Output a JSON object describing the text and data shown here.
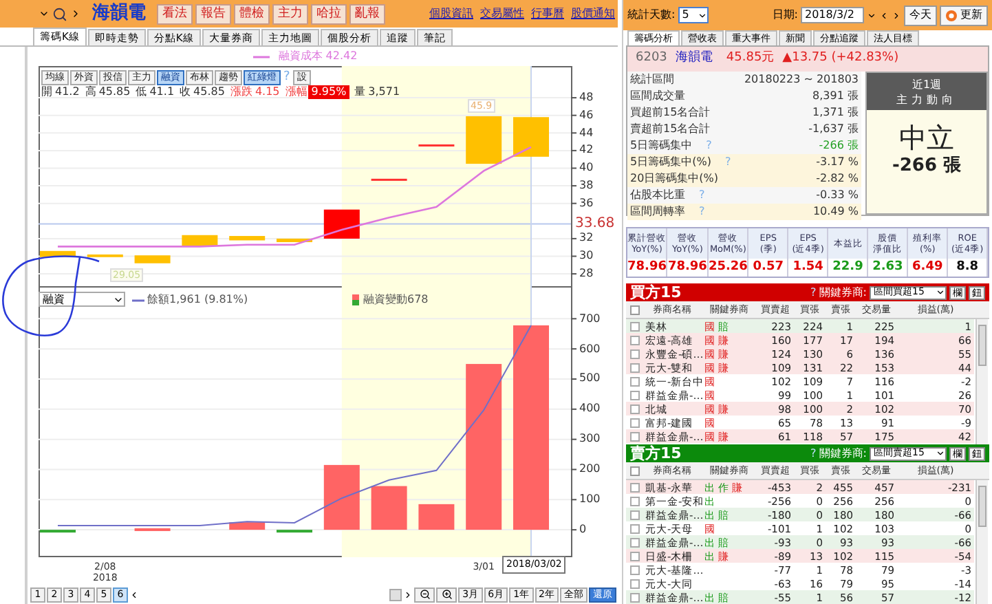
{
  "header": {
    "stock": "海韻電",
    "buttons": [
      "看法",
      "報告",
      "體檢",
      "主力",
      "哈拉",
      "亂報"
    ],
    "links": [
      "個股資訊",
      "交易屬性",
      "行事曆",
      "股價通知"
    ]
  },
  "tabs": [
    {
      "label": "籌碼K線",
      "selected": true
    },
    {
      "label": "即時走勢",
      "selected": false
    },
    {
      "label": "分點K線",
      "selected": false
    },
    {
      "label": "大量券商",
      "selected": false
    },
    {
      "label": "主力地圖",
      "selected": false
    },
    {
      "label": "個股分析",
      "selected": false
    },
    {
      "label": "追蹤",
      "selected": false
    },
    {
      "label": "筆記",
      "selected": false
    }
  ],
  "price_chart": {
    "tools": [
      {
        "kind": "button",
        "label": "均線",
        "selected": false
      },
      {
        "kind": "button",
        "label": "外資",
        "selected": false
      },
      {
        "kind": "button",
        "label": "投信",
        "selected": false
      },
      {
        "kind": "button",
        "label": "主力",
        "selected": false
      },
      {
        "kind": "button",
        "label": "融資",
        "selected": true
      },
      {
        "kind": "button",
        "label": "布林",
        "selected": false
      },
      {
        "kind": "button",
        "label": "趨勢",
        "selected": false
      },
      {
        "kind": "button",
        "label": "紅綠燈",
        "selected": true
      },
      {
        "kind": "hint",
        "label": "?"
      },
      {
        "kind": "button",
        "label": "設",
        "selected": false
      }
    ],
    "quote": [
      {
        "kind": "plain",
        "label": "開",
        "value": "41.2"
      },
      {
        "kind": "plain",
        "label": "高",
        "value": "45.85"
      },
      {
        "kind": "plain",
        "label": "低",
        "value": "41.1"
      },
      {
        "kind": "plain",
        "label": "收",
        "value": "45.85"
      },
      {
        "kind": "up",
        "label": "漲跌",
        "value": "4.15"
      },
      {
        "kind": "badge",
        "label": "漲幅",
        "value": "9.95%"
      },
      {
        "kind": "plain",
        "label": "量",
        "value": "3,571"
      }
    ],
    "high_label": "45.9",
    "low_label": "29.05",
    "chart_data": {
      "type": "line",
      "ylim": [
        26.6,
        51.6
      ],
      "yticks": [
        28,
        30,
        32,
        36,
        38,
        40,
        42,
        44,
        46,
        48
      ],
      "grid": true,
      "ref_lines": [
        {
          "axis": "y",
          "value": 33.68,
          "label": "33.68",
          "color": "#b8c8ee"
        }
      ],
      "series": [
        {
          "name": "融資成本 42.42",
          "color": "#dd77dd",
          "values": [
            31.1,
            31.1,
            31.1,
            31.1,
            31.3,
            31.3,
            33.0,
            34.4,
            35.6,
            39.7,
            42.4
          ]
        }
      ]
    }
  },
  "margin_chart": {
    "indicator": "融資",
    "chart_data": {
      "type": "bar",
      "ylim": [
        -91,
        808
      ],
      "yticks": [
        0,
        100,
        200,
        300,
        400,
        500,
        600,
        700
      ],
      "grid": true,
      "legend": "top",
      "series": [
        {
          "name": "餘額1,961 (9.81%)",
          "type": "line",
          "color": "#6f6fc8",
          "values": [
            14,
            14,
            14,
            14,
            27,
            23,
            105,
            165,
            197,
            397,
            678
          ]
        },
        {
          "name": "融資變動678",
          "type": "bar",
          "color": "#ff6464",
          "values": [
            null,
            null,
            5,
            null,
            25,
            null,
            215,
            145,
            85,
            550,
            678
          ]
        },
        {
          "type": "bar",
          "color": "#33aa33",
          "values": [
            -8,
            null,
            null,
            null,
            null,
            -8,
            null,
            null,
            null,
            null,
            null
          ]
        }
      ]
    }
  },
  "dates": [
    {
      "label": "2/08",
      "sub": "2018"
    },
    {
      "label": "3/01"
    }
  ],
  "cursor_date": "2018/03/02",
  "pages": [
    {
      "label": "1",
      "selected": false
    },
    {
      "label": "2",
      "selected": false
    },
    {
      "label": "3",
      "selected": false
    },
    {
      "label": "4",
      "selected": false
    },
    {
      "label": "5",
      "selected": false
    },
    {
      "label": "6",
      "selected": true
    }
  ],
  "ranges": [
    {
      "label": "3月",
      "selected": false
    },
    {
      "label": "6月",
      "selected": false
    },
    {
      "label": "1年",
      "selected": false
    },
    {
      "label": "2年",
      "selected": false
    },
    {
      "label": "全部",
      "selected": false
    },
    {
      "label": "還原",
      "selected": true
    }
  ],
  "toolbar": {
    "days_label": "統計天數:",
    "days": "5",
    "date_label": "日期:",
    "date": "2018/3/2",
    "today": "今天",
    "refresh": "更新"
  },
  "right_tabs": [
    {
      "label": "籌碼分析",
      "selected": true
    },
    {
      "label": "營收表",
      "selected": false
    },
    {
      "label": "重大事件",
      "selected": false
    },
    {
      "label": "新聞",
      "selected": false
    },
    {
      "label": "分點追蹤",
      "selected": false
    },
    {
      "label": "法人目標",
      "selected": false
    }
  ],
  "stock": {
    "code": "6203",
    "name": "海韻電",
    "price": "45.85元",
    "change": "▲13.75 (+42.83%)"
  },
  "stats": [
    {
      "label": "統計區間",
      "value": "20180223 ~ 201803",
      "shaded": false,
      "color": "#333333"
    },
    {
      "label": "區間成交量",
      "value": "8,391 張",
      "shaded": false,
      "color": "#333333"
    },
    {
      "label": "買超前15名合計",
      "value": "1,371 張",
      "shaded": false,
      "color": "#333333"
    },
    {
      "label": "賣超前15名合計",
      "value": "-1,637 張",
      "shaded": false,
      "color": "#333333"
    },
    {
      "label": "5日籌碼集中",
      "hint": "?",
      "value": "-266 張",
      "shaded": false,
      "color": "#22a022"
    },
    {
      "label": "5日籌碼集中(%)",
      "hint": "?",
      "value": "-3.17 %",
      "shaded": true,
      "color": "#333333"
    },
    {
      "label": "20日籌碼集中(%)",
      "value": "-2.82 %",
      "shaded": true,
      "color": "#333333"
    },
    {
      "label": "佔股本比重",
      "hint": "?",
      "value": "-0.33 %",
      "shaded": false,
      "color": "#333333"
    },
    {
      "label": "區間周轉率",
      "hint": "?",
      "value": "10.49 %",
      "shaded": true,
      "color": "#333333"
    }
  ],
  "trend": {
    "period": "近1週",
    "title": "主力動向",
    "verdict": "中立",
    "amount": "-266 張"
  },
  "fundamentals": [
    {
      "title": "累計營收",
      "sub": "YoY(%)",
      "value": "78.96",
      "color": "#e00000"
    },
    {
      "title": "營收",
      "sub": "YoY(%)",
      "value": "78.96",
      "color": "#e00000"
    },
    {
      "title": "營收",
      "sub": "MoM(%)",
      "value": "25.26",
      "color": "#e00000"
    },
    {
      "title": "EPS",
      "sub": "(季)",
      "value": "0.57",
      "color": "#e00000"
    },
    {
      "title": "EPS",
      "sub": "(近4季)",
      "value": "1.54",
      "color": "#e00000"
    },
    {
      "title": "本益比",
      "value": "22.9",
      "color": "#1a9a1a"
    },
    {
      "title": "股價",
      "sub": "淨值比",
      "value": "2.63",
      "color": "#1a9a1a"
    },
    {
      "title": "殖利率",
      "sub": "(%)",
      "value": "6.49",
      "color": "#e00000"
    },
    {
      "title": "ROE",
      "sub": "(近4季)",
      "value": "8.8",
      "color": "#111111"
    }
  ],
  "buy": {
    "title": "買方15",
    "all_checked": false,
    "hint": "?",
    "key_label": "關鍵券商:",
    "filter": "區間買超15",
    "buttons": [
      "欄",
      "鈕"
    ],
    "columns": [
      "券商名稱",
      "關鍵券商",
      "買賣超",
      "買張",
      "賣張",
      "交易量",
      "損益(萬)"
    ],
    "rows": [
      {
        "checked": false,
        "broker": "美林",
        "tags": [
          {
            "text": "國",
            "color": "#e02020"
          },
          {
            "text": "賠",
            "color": "#1a9a1a"
          }
        ],
        "net": "223",
        "buy": "224",
        "sell": "1",
        "volume": "225",
        "pl": "1",
        "color": "#e8f3e8"
      },
      {
        "checked": false,
        "broker": "宏遠-高雄",
        "tags": [
          {
            "text": "國",
            "color": "#e02020"
          },
          {
            "text": "賺",
            "color": "#e02020"
          }
        ],
        "net": "160",
        "buy": "177",
        "sell": "17",
        "volume": "194",
        "pl": "66",
        "color": "#fbe6e6"
      },
      {
        "checked": false,
        "broker": "永豐金-碩…",
        "tags": [
          {
            "text": "國",
            "color": "#e02020"
          },
          {
            "text": "賺",
            "color": "#e02020"
          }
        ],
        "net": "124",
        "buy": "130",
        "sell": "6",
        "volume": "136",
        "pl": "55",
        "color": "#fbe6e6"
      },
      {
        "checked": false,
        "broker": "元大-雙和",
        "tags": [
          {
            "text": "國",
            "color": "#e02020"
          },
          {
            "text": "賺",
            "color": "#e02020"
          }
        ],
        "net": "109",
        "buy": "131",
        "sell": "22",
        "volume": "153",
        "pl": "44",
        "color": "#fbe6e6"
      },
      {
        "checked": false,
        "broker": "統一-新台中",
        "tags": [
          {
            "text": "國",
            "color": "#e02020"
          }
        ],
        "net": "102",
        "buy": "109",
        "sell": "7",
        "volume": "116",
        "pl": "-2",
        "color": "#ffffff"
      },
      {
        "checked": false,
        "broker": "群益金鼎-…",
        "tags": [
          {
            "text": "國",
            "color": "#e02020"
          }
        ],
        "net": "99",
        "buy": "100",
        "sell": "1",
        "volume": "101",
        "pl": "26",
        "color": "#ffffff"
      },
      {
        "checked": false,
        "broker": "北城",
        "tags": [
          {
            "text": "國",
            "color": "#e02020"
          },
          {
            "text": "賺",
            "color": "#e02020"
          }
        ],
        "net": "98",
        "buy": "100",
        "sell": "2",
        "volume": "102",
        "pl": "70",
        "color": "#fbe6e6"
      },
      {
        "checked": false,
        "broker": "富邦-建國",
        "tags": [
          {
            "text": "國",
            "color": "#e02020"
          }
        ],
        "net": "65",
        "buy": "78",
        "sell": "13",
        "volume": "91",
        "pl": "-9",
        "color": "#ffffff"
      },
      {
        "checked": false,
        "broker": "群益金鼎-…",
        "tags": [
          {
            "text": "國",
            "color": "#e02020"
          },
          {
            "text": "賺",
            "color": "#e02020"
          }
        ],
        "net": "61",
        "buy": "118",
        "sell": "57",
        "volume": "175",
        "pl": "42",
        "color": "#fbe6e6"
      }
    ]
  },
  "sell": {
    "title": "賣方15",
    "all_checked": false,
    "hint": "?",
    "key_label": "關鍵券商:",
    "filter": "區間賣超15",
    "buttons": [
      "欄",
      "鈕"
    ],
    "columns": [
      "券商名稱",
      "關鍵券商",
      "買賣超",
      "買張",
      "賣張",
      "交易量",
      "損益(萬)"
    ],
    "rows": [
      {
        "checked": false,
        "broker": "凱基-永華",
        "tags": [
          {
            "text": "出",
            "color": "#1a9a1a"
          },
          {
            "text": "作",
            "color": "#1a9a1a"
          },
          {
            "text": "賺",
            "color": "#e02020"
          }
        ],
        "net": "-453",
        "buy": "2",
        "sell": "455",
        "volume": "457",
        "pl": "-231",
        "color": "#fbe6e6"
      },
      {
        "checked": false,
        "broker": "第一金-安和",
        "tags": [
          {
            "text": "出",
            "color": "#1a9a1a"
          }
        ],
        "net": "-256",
        "buy": "0",
        "sell": "256",
        "volume": "256",
        "pl": "0",
        "color": "#ffffff"
      },
      {
        "checked": false,
        "broker": "群益金鼎-…",
        "tags": [
          {
            "text": "出",
            "color": "#1a9a1a"
          },
          {
            "text": "賠",
            "color": "#1a9a1a"
          }
        ],
        "net": "-180",
        "buy": "0",
        "sell": "180",
        "volume": "180",
        "pl": "-66",
        "color": "#e8f3e8"
      },
      {
        "checked": false,
        "broker": "元大-天母",
        "tags": [
          {
            "text": "國",
            "color": "#e02020"
          }
        ],
        "net": "-101",
        "buy": "1",
        "sell": "102",
        "volume": "103",
        "pl": "0",
        "color": "#ffffff"
      },
      {
        "checked": false,
        "broker": "群益金鼎-…",
        "tags": [
          {
            "text": "出",
            "color": "#1a9a1a"
          },
          {
            "text": "賠",
            "color": "#1a9a1a"
          }
        ],
        "net": "-93",
        "buy": "0",
        "sell": "93",
        "volume": "93",
        "pl": "-66",
        "color": "#e8f3e8"
      },
      {
        "checked": false,
        "broker": "日盛-木柵",
        "tags": [
          {
            "text": "出",
            "color": "#1a9a1a"
          },
          {
            "text": "賺",
            "color": "#e02020"
          }
        ],
        "net": "-89",
        "buy": "13",
        "sell": "102",
        "volume": "115",
        "pl": "-54",
        "color": "#fbe6e6"
      },
      {
        "checked": false,
        "broker": "元大-基隆…",
        "net": "-77",
        "buy": "1",
        "sell": "78",
        "volume": "79",
        "pl": "-3",
        "color": "#ffffff"
      },
      {
        "checked": false,
        "broker": "元大-大同",
        "net": "-63",
        "buy": "16",
        "sell": "79",
        "volume": "95",
        "pl": "-14",
        "color": "#ffffff"
      },
      {
        "checked": false,
        "broker": "群益金鼎-…",
        "tags": [
          {
            "text": "出",
            "color": "#1a9a1a"
          },
          {
            "text": "賠",
            "color": "#1a9a1a"
          }
        ],
        "net": "-55",
        "buy": "1",
        "sell": "56",
        "volume": "57",
        "pl": "-12",
        "color": "#e8f3e8"
      }
    ]
  }
}
